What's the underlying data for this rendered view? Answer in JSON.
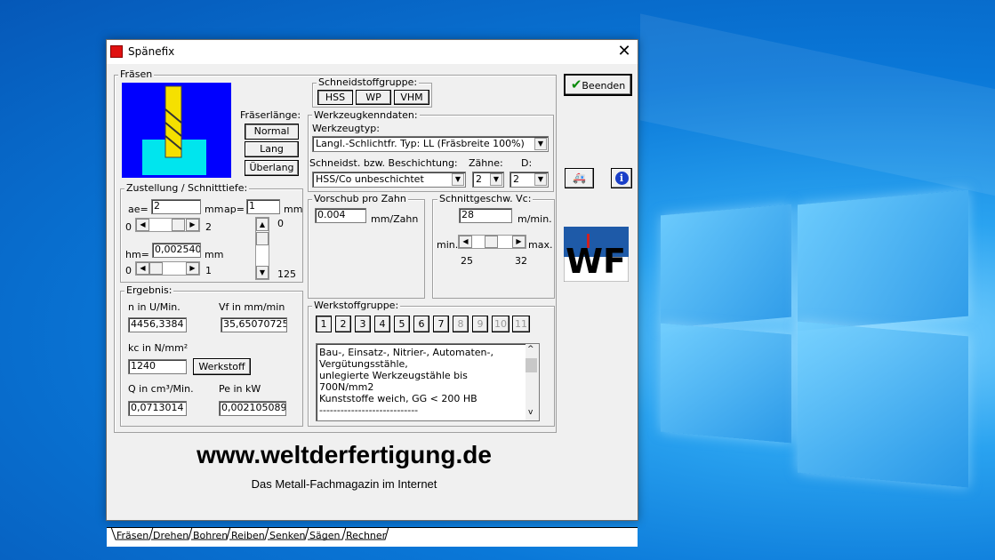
{
  "window": {
    "title": "Spänefix",
    "close_glyph": "✕"
  },
  "milling": {
    "group_label": "Fräsen",
    "length_label": "Fräserlänge:",
    "length_options": [
      "Normal",
      "Lang",
      "Überlang"
    ],
    "infeed": {
      "label": "Zustellung / Schnitttiefe:",
      "ae_label": "ae=",
      "ae_value": "2",
      "ae_unit": "mm",
      "ap_label": "ap=",
      "ap_value": "1",
      "ap_unit": "mm",
      "ae_min": "0",
      "ae_max": "2",
      "ap_min": "0",
      "ap_max": "125",
      "hm_label": "hm=",
      "hm_value": "0,002540",
      "hm_unit": "mm",
      "hm_min": "0",
      "hm_max": "1"
    },
    "result": {
      "label": "Ergebnis:",
      "n_label": "n in U/Min.",
      "n_value": "4456,3384",
      "vf_label": "Vf in mm/min",
      "vf_value": "35,65070725",
      "kc_label": "kc in N/mm²",
      "kc_value": "1240",
      "werkstoff_button": "Werkstoff",
      "q_label": "Q in cm³/Min.",
      "q_value": "0,0713014",
      "pe_label": "Pe in kW",
      "pe_value": "0,002105089"
    }
  },
  "cutting_material": {
    "label": "Schneidstoffgruppe:",
    "options": [
      "HSS",
      "WP",
      "VHM"
    ],
    "selected": "HSS"
  },
  "tool_data": {
    "label": "Werkzeugkenndaten:",
    "type_label": "Werkzeugtyp:",
    "type_value": "Langl.-Schlichtfr. Typ: LL (Fräsbreite 100%)",
    "coating_label": "Schneidst. bzw. Beschichtung:",
    "coating_value": "HSS/Co unbeschichtet",
    "teeth_label": "Zähne:",
    "teeth_value": "2",
    "d_label": "D:",
    "d_value": "2"
  },
  "feed": {
    "label": "Vorschub pro Zahn",
    "value": "0.004",
    "unit": "mm/Zahn"
  },
  "speed": {
    "label": "Schnittgeschw. Vc:",
    "value": "28",
    "unit": "m/min.",
    "min_label": "min.",
    "max_label": "max.",
    "min": "25",
    "max": "32"
  },
  "material": {
    "label": "Werkstoffgruppe:",
    "tabs": [
      "1",
      "2",
      "3",
      "4",
      "5",
      "6",
      "7",
      "8",
      "9",
      "10",
      "11"
    ],
    "description": [
      "Bau-, Einsatz-, Nitrier-, Automaten-,",
      "Vergütungsstähle,",
      "unlegierte Werkzeugstähle bis",
      "700N/mm2",
      "Kunststoffe weich, GG < 200 HB",
      "----------------------------"
    ]
  },
  "buttons": {
    "exit": "Beenden"
  },
  "footer": {
    "url": "www.weltderfertigung.de",
    "tagline": "Das Metall-Fachmagazin im Internet"
  },
  "tabs": [
    "Fräsen",
    "Drehen",
    "Bohren",
    "Reiben",
    "Senken",
    "Sägen",
    "Rechner"
  ],
  "logo_text": "WF",
  "colors": {
    "accent_blue": "#0000ff",
    "cyan": "#00e5ee",
    "tool_yellow": "#f5e000",
    "logo_blue": "#1e5aa8"
  }
}
